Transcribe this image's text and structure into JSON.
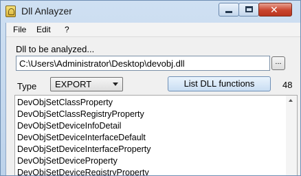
{
  "window": {
    "title": "Dll Anlayzer"
  },
  "menu": {
    "file": "File",
    "edit": "Edit",
    "help": "?"
  },
  "form": {
    "dll_label": "Dll to be analyzed...",
    "dll_path": "C:\\Users\\Administrator\\Desktop\\devobj.dll",
    "browse_label": "...",
    "type_label": "Type",
    "type_value": "EXPORT",
    "list_button": "List DLL functions",
    "count": "48"
  },
  "functions": [
    "DevObjSetClassProperty",
    "DevObjSetClassRegistryProperty",
    "DevObjSetDeviceInfoDetail",
    "DevObjSetDeviceInterfaceDefault",
    "DevObjSetDeviceInterfaceProperty",
    "DevObjSetDeviceProperty",
    "DevObjSetDeviceRegistryProperty"
  ],
  "icons": {
    "app": "dll-analyzer-icon",
    "minimize": "minimize-icon",
    "maximize": "maximize-icon",
    "close": "close-icon",
    "dropdown": "chevron-down-icon",
    "scroll_up": "scroll-up-arrow-icon"
  }
}
